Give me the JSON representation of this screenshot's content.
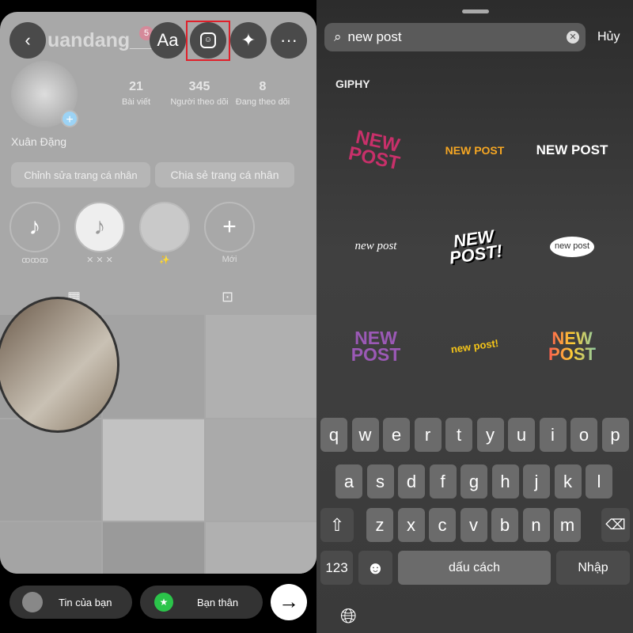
{
  "profile": {
    "username": "uandang__",
    "badge": "5",
    "name": "Xuân Đặng",
    "stats": [
      {
        "value": "21",
        "label": "Bài viết"
      },
      {
        "value": "345",
        "label": "Người theo dõi"
      },
      {
        "value": "8",
        "label": "Đang theo dõi"
      }
    ],
    "edit_label": "Chỉnh sửa trang cá nhân",
    "share_label": "Chia sẻ trang cá nhân",
    "highlights": [
      {
        "label": "ꝏꝏꝏ",
        "icon": "♪"
      },
      {
        "label": "✕ ✕ ✕",
        "icon": "♪"
      },
      {
        "label": "✨",
        "icon": ""
      },
      {
        "label": "Mới",
        "icon": "+"
      }
    ]
  },
  "toolbar": {
    "back": "‹",
    "text": "Aa",
    "sticker": "sticker-icon",
    "effects": "sparkles-icon",
    "more": "···",
    "highlight_color": "#e0202a"
  },
  "bottom": {
    "your_story": "Tin của bạn",
    "close_friends": "Bạn thân",
    "send": "→"
  },
  "search": {
    "value": "new post",
    "cancel": "Hủy"
  },
  "section": "GIPHY",
  "stickers": [
    "NEW POST",
    "NEW POST",
    "NEW POST",
    "new post",
    "NEW POST!",
    "new post",
    "NEW POST",
    "new post!",
    "NEW POST"
  ],
  "keyboard": {
    "row1": [
      "q",
      "w",
      "e",
      "r",
      "t",
      "y",
      "u",
      "i",
      "o",
      "p"
    ],
    "row2": [
      "a",
      "s",
      "d",
      "f",
      "g",
      "h",
      "j",
      "k",
      "l"
    ],
    "row3": [
      "z",
      "x",
      "c",
      "v",
      "b",
      "n",
      "m"
    ],
    "num": "123",
    "space": "dấu cách",
    "enter": "Nhập"
  }
}
